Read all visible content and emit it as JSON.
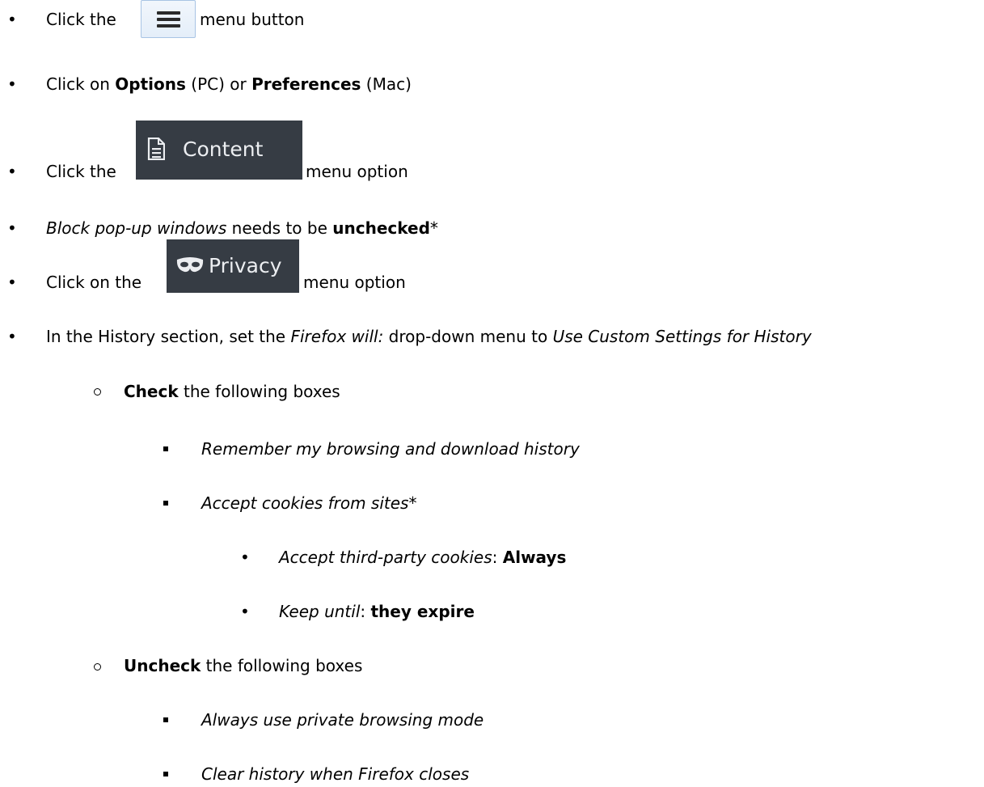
{
  "instructions": [
    {
      "prefix": "Click the ",
      "suffix": " menu button",
      "image": "hamburger-menu-icon"
    },
    {
      "text_parts": [
        {
          "t": "Click on ",
          "style": "normal"
        },
        {
          "t": "Options",
          "style": "bold"
        },
        {
          "t": " (PC) or ",
          "style": "normal"
        },
        {
          "t": "Preferences",
          "style": "bold"
        },
        {
          "t": " (Mac)",
          "style": "normal"
        }
      ]
    },
    {
      "prefix": "Click the ",
      "suffix": " menu option",
      "image_label": "Content",
      "image_icon": "document-icon"
    },
    {
      "text_parts": [
        {
          "t": "Block pop-up windows",
          "style": "italic"
        },
        {
          "t": " needs to be ",
          "style": "normal"
        },
        {
          "t": "unchecked",
          "style": "bold"
        },
        {
          "t": "*",
          "style": "normal"
        }
      ]
    },
    {
      "prefix": "Click on the ",
      "suffix": " menu option",
      "image_label": "Privacy",
      "image_icon": "mask-icon"
    },
    {
      "text_parts": [
        {
          "t": "In the History section, set the ",
          "style": "normal"
        },
        {
          "t": "Firefox will:",
          "style": "italic"
        },
        {
          "t": " drop-down menu to ",
          "style": "normal"
        },
        {
          "t": "Use Custom Settings for History",
          "style": "italic"
        }
      ]
    }
  ],
  "check": {
    "bold": "Check",
    "rest": " the following boxes",
    "items": [
      "Remember my browsing and download history",
      "Accept cookies from sites*"
    ],
    "subitems": [
      {
        "label": "Accept third-party cookies",
        "sep": ": ",
        "value": "Always"
      },
      {
        "label": "Keep until",
        "sep": ": ",
        "value": "they expire"
      }
    ]
  },
  "uncheck": {
    "bold": "Uncheck",
    "rest": " the following boxes",
    "items": [
      "Always use private browsing mode",
      "Clear history when Firefox closes"
    ]
  }
}
